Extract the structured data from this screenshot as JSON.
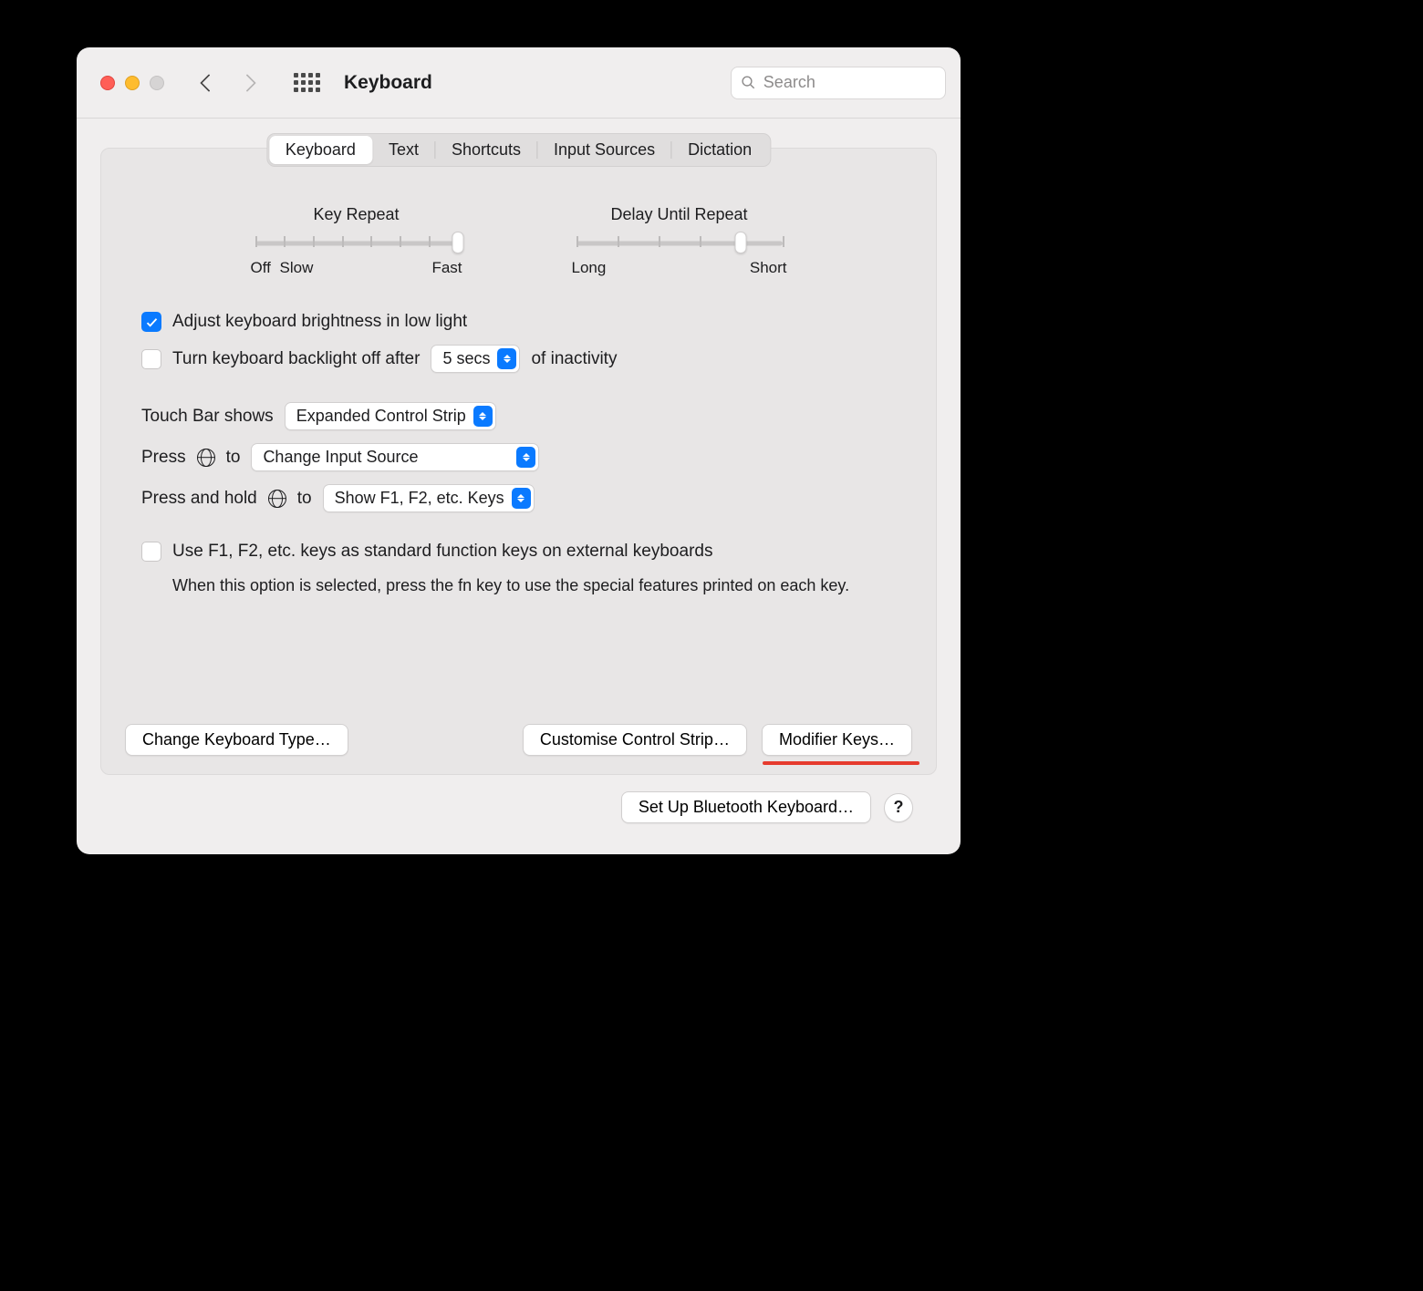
{
  "header": {
    "title": "Keyboard",
    "search_placeholder": "Search"
  },
  "tabs": [
    "Keyboard",
    "Text",
    "Shortcuts",
    "Input Sources",
    "Dictation"
  ],
  "active_tab": 0,
  "sliders": {
    "key_repeat": {
      "title": "Key Repeat",
      "min_label": "Off",
      "second_label": "Slow",
      "max_label": "Fast",
      "ticks": 8,
      "value": 7
    },
    "delay_until_repeat": {
      "title": "Delay Until Repeat",
      "min_label": "Long",
      "max_label": "Short",
      "ticks": 6,
      "value": 4
    }
  },
  "options": {
    "adjust_brightness": {
      "label": "Adjust keyboard brightness in low light",
      "checked": true
    },
    "backlight_off": {
      "label_before": "Turn keyboard backlight off after",
      "value": "5 secs",
      "label_after": "of inactivity",
      "checked": false
    },
    "touch_bar": {
      "label": "Touch Bar shows",
      "value": "Expanded Control Strip"
    },
    "press_globe": {
      "label_before": "Press",
      "label_after": "to",
      "value": "Change Input Source"
    },
    "press_hold_globe": {
      "label_before": "Press and hold",
      "label_after": "to",
      "value": "Show F1, F2, etc. Keys"
    },
    "fn_keys": {
      "label": "Use F1, F2, etc. keys as standard function keys on external keyboards",
      "hint": "When this option is selected, press the fn key to use the special features printed on each key.",
      "checked": false
    }
  },
  "buttons": {
    "change_keyboard_type": "Change Keyboard Type…",
    "customise_control_strip": "Customise Control Strip…",
    "modifier_keys": "Modifier Keys…",
    "setup_bluetooth": "Set Up Bluetooth Keyboard…",
    "help": "?"
  },
  "annotation": {
    "underline_color": "#e63b2e"
  }
}
